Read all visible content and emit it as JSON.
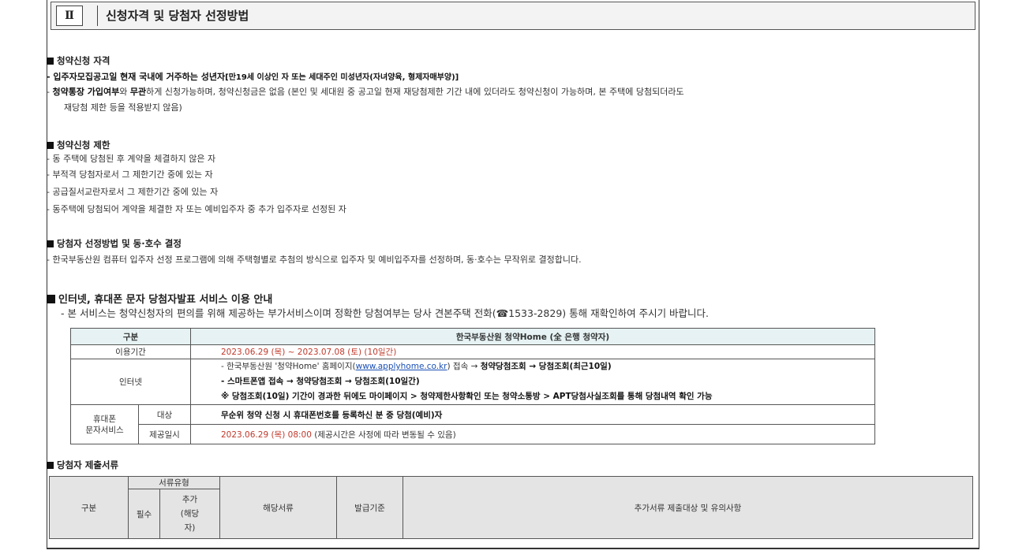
{
  "section": {
    "num": "Ⅱ",
    "title": "신청자격 및 당첨자 선정방법"
  },
  "s1": {
    "heading": "청약신청 자격",
    "l1_a": "- 입주자모집공고일 현재 국내에 거주하는 성년자",
    "l1_b": "[만19세 이상인 자 또는 세대주인 미성년자(자녀양육, 형제자매부양)]",
    "l2_a": "- ",
    "l2_b": "청약통장 가입여부",
    "l2_c": "와 ",
    "l2_d": "무관",
    "l2_e": "하게 신청가능하며, 청약신청금은 없음 (본인 및 세대원 중 공고일 현재 재당첨제한 기간 내에 있더라도 청약신청이 가능하며, 본 주택에 당첨되더라도",
    "l3": "재당첨 제한 등을 적용받지 않음)"
  },
  "s2": {
    "heading": "청약신청 제한",
    "items": [
      "- 동 주택에 당첨된 후 계약을 체결하지 않은 자",
      "- 부적격 당첨자로서 그 제한기간 중에 있는 자",
      "- 공급질서교란자로서 그 제한기간 중에 있는 자",
      "- 동주택에 당첨되어 계약을 체결한 자 또는 예비입주자 중 추가 입주자로 선정된 자"
    ]
  },
  "s3": {
    "heading": "당첨자 선정방법 및 동·호수 결정",
    "line": "- 한국부동산원 컴퓨터 입주자 선정 프로그램에 의해 주택형별로 추첨의 방식으로 입주자 및 예비입주자를 선정하며, 동·호수는 무작위로 결정합니다."
  },
  "s4": {
    "heading": "인터넷, 휴대폰 문자 당첨자발표 서비스 이용 안내",
    "line": "- 본 서비스는 청약신청자의 편의를 위해 제공하는 부가서비스이며 정확한 당첨여부는 당사 견본주택 전화(☎1533-2829) 통해 재확인하여 주시기 바랍니다."
  },
  "t1": {
    "h_col1": "구분",
    "h_col2": "한국부동산원 청약Home (全 은행 청약자)",
    "r1_label": "이용기간",
    "r1_value": "2023.06.29 (목) ~ 2023.07.08 (토) (10일간)",
    "r2_label": "인터넷",
    "r2_l1_a": "- 한국부동산원 '청약Home' 홈페이지(",
    "r2_l1_link": "www.applyhome.co.kr",
    "r2_l1_b": ") 접속 → ",
    "r2_l1_c": "청약당첨조회 → 당첨조회(최근10일)",
    "r2_l2": "- 스마트폰앱 접속  → 청약당첨조회 → 당첨조회(10일간)",
    "r2_l3": "※ 당첨조회(10일) 기간이 경과한 뒤에도 마이페이지 > 청약제한사항확인 또는 청약소통방 > APT당첨사실조회를 통해 당첨내역 확인 가능",
    "r3_group": "휴대폰\n문자서비스",
    "r3_label": "대상",
    "r3_value": "무순위 청약 신청 시 휴대폰번호를 등록하신 분 중 당첨(예비)자",
    "r4_label": "제공일시",
    "r4_value_a": "2023.06.29 (목) 08:00",
    "r4_value_b": " (제공시간은 사정에 따라 변동될 수 있음)"
  },
  "s5": {
    "heading": "당첨자 제출서류"
  },
  "t2": {
    "col_gubun": "구분",
    "col_type": "서류유형",
    "col_req": "필수",
    "col_add": "추가\n(해당\n자)",
    "col_doc": "해당서류",
    "col_issue": "발급기준",
    "col_note": "추가서류 제출대상 및 유의사항"
  }
}
